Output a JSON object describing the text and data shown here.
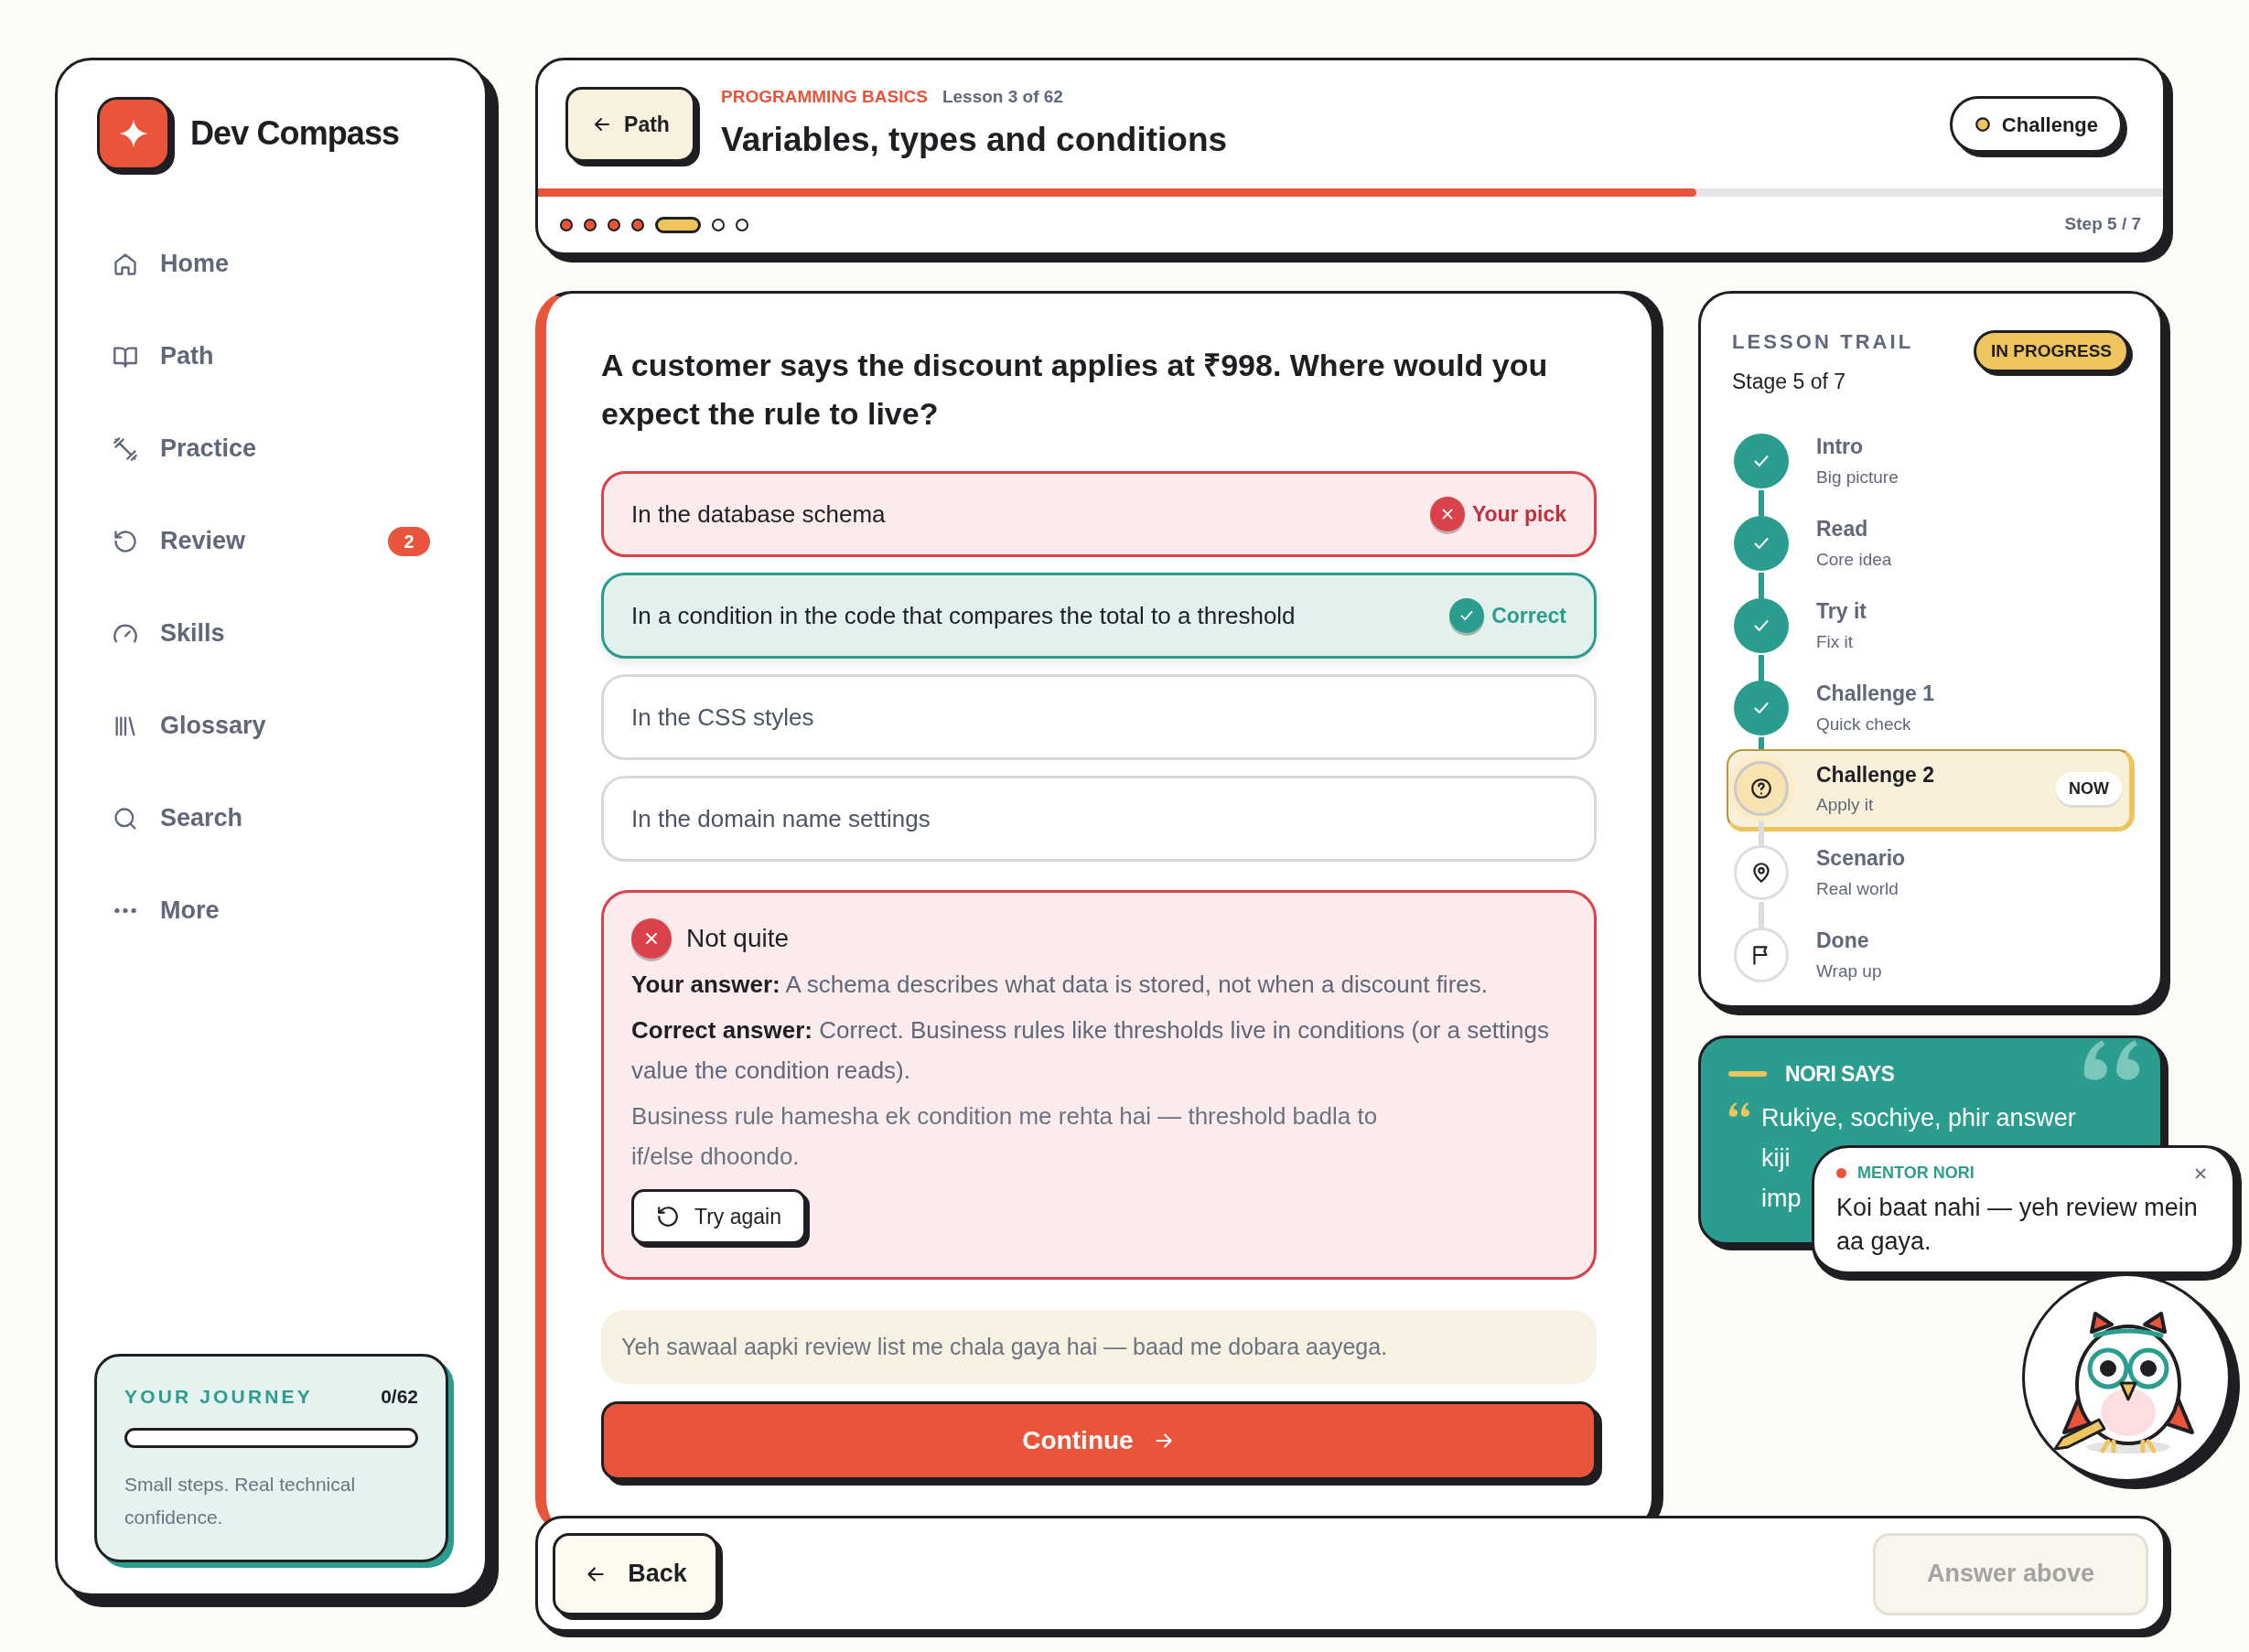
{
  "app": {
    "name": "Dev Compass"
  },
  "sidebar": {
    "items": [
      {
        "label": "Home"
      },
      {
        "label": "Path"
      },
      {
        "label": "Practice"
      },
      {
        "label": "Review",
        "badge": "2"
      },
      {
        "label": "Skills"
      },
      {
        "label": "Glossary"
      },
      {
        "label": "Search"
      },
      {
        "label": "More"
      }
    ],
    "journey": {
      "title": "YOUR JOURNEY",
      "count": "0/62",
      "level": 0,
      "text": "Small steps. Real technical confidence."
    }
  },
  "header": {
    "back_button": "Path",
    "course": "PROGRAMMING BASICS",
    "lesson": "Lesson 3 of 62",
    "title": "Variables, types and conditions",
    "mode_button": "Challenge",
    "progress": {
      "level": 0.713
    },
    "steps": [
      {
        "done": true,
        "current": false
      },
      {
        "done": true,
        "current": false
      },
      {
        "done": true,
        "current": false
      },
      {
        "done": true,
        "current": false
      },
      {
        "done": false,
        "current": true
      },
      {
        "done": false,
        "current": false
      },
      {
        "done": false,
        "current": false
      }
    ],
    "step_label": "Step 5 / 7"
  },
  "question": {
    "prompt": "A customer says the discount applies at ₹998. Where would you expect the rule to live?",
    "options": [
      {
        "text": "In the database schema",
        "kind": "wrong_pick",
        "tag": "Your pick"
      },
      {
        "text": "In a condition in the code that compares the total to a threshold",
        "kind": "correct",
        "tag": "Correct"
      },
      {
        "text": "In the CSS styles",
        "kind": "plain"
      },
      {
        "text": "In the domain name settings",
        "kind": "plain"
      }
    ],
    "feedback": {
      "title": "Not quite",
      "your_answer": "**Your answer:** A schema describes what data is stored, not when a discount fires.",
      "correct_answer": "**Correct answer:** Correct. Business rules like thresholds live in conditions (or a settings value the condition reads).",
      "hint": "Business rule hamesha ek condition me rehta hai — threshold badla to if/else dhoondo.",
      "retry_button": "Try again"
    },
    "note": "Yeh sawaal aapki review list me chala gaya hai — baad me dobara aayega.",
    "continue_button": "Continue"
  },
  "lesson_trail": {
    "title": "LESSON TRAIL",
    "stage": "Stage 5 of 7",
    "badge": "IN PROGRESS",
    "steps": [
      {
        "title": "Intro",
        "subtitle": "Big picture",
        "done": true,
        "current": false
      },
      {
        "title": "Read",
        "subtitle": "Core idea",
        "done": true,
        "current": false
      },
      {
        "title": "Try it",
        "subtitle": "Fix it",
        "done": true,
        "current": false
      },
      {
        "title": "Challenge 1",
        "subtitle": "Quick check",
        "done": true,
        "current": false
      },
      {
        "title": "Challenge 2",
        "subtitle": "Apply it",
        "done": false,
        "current": true,
        "badge": "NOW"
      },
      {
        "title": "Scenario",
        "subtitle": "Real world",
        "done": false,
        "current": false
      },
      {
        "title": "Done",
        "subtitle": "Wrap up",
        "done": false,
        "current": false
      }
    ]
  },
  "nori_card": {
    "title": "NORI SAYS",
    "lines": [
      "Rukiye, sochiye, phir answer",
      "kiji",
      "imp"
    ]
  },
  "mentor_bubble": {
    "label": "MENTOR NORI",
    "message": "Koi baat nahi — yeh review mein aa gaya."
  },
  "footer": {
    "back_button": "Back",
    "next_button": {
      "label": "Answer above",
      "disabled": true
    }
  }
}
